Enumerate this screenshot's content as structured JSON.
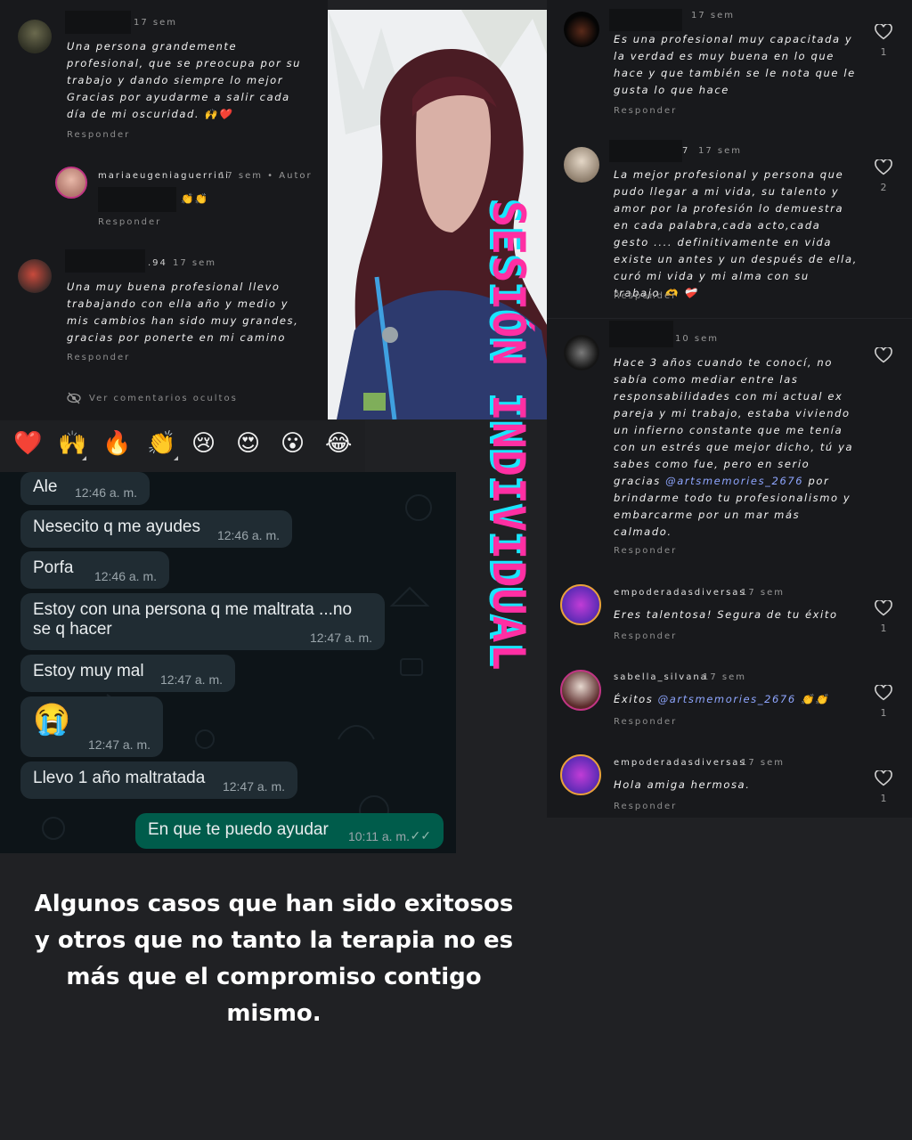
{
  "left_comments": [
    {
      "time": "17 sem",
      "text": "Una persona grandemente profesional, que se preocupa por su trabajo y dando siempre lo mejor Gracias por ayudarme a salir cada día de mi oscuridad. 🙌❤️",
      "reply": "Responder"
    },
    {
      "username": "mariaeugeniaguerrini",
      "time": "17 sem • Autor",
      "text": "👏👏",
      "reply": "Responder"
    },
    {
      "username_suffix": ".94",
      "time": "17 sem",
      "text": "Una muy buena profesional llevo trabajando con ella año y medio y mis cambios han sido muy grandes, gracias por ponerte en mi camino",
      "reply": "Responder"
    }
  ],
  "hidden_comments": "Ver comentarios ocultos",
  "emoji_bar": [
    "❤️",
    "🙌",
    "🔥",
    "👏",
    "😢",
    "😍",
    "😮",
    "😂"
  ],
  "chat": {
    "messages": [
      {
        "text": "Ale",
        "time": "12:46 a. m."
      },
      {
        "text": "Nesecito q me ayudes",
        "time": "12:46 a. m."
      },
      {
        "text": "Porfa",
        "time": "12:46 a. m."
      },
      {
        "text_line1": "Estoy con una persona q me maltrata ...no",
        "text_line2": "se q hacer",
        "time": "12:47 a. m."
      },
      {
        "text": "Estoy muy mal",
        "time": "12:47 a. m."
      },
      {
        "text": "😭",
        "time": "12:47 a. m."
      },
      {
        "text": "Llevo 1 año maltratada",
        "time": "12:47 a. m."
      },
      {
        "text": "En que te puedo ayudar",
        "time": "10:11 a. m.",
        "ticks": "✓✓"
      }
    ]
  },
  "right_comments": [
    {
      "time": "17 sem",
      "text": "Es una profesional muy capacitada y la verdad es muy buena en lo que hace y que también se le nota que le gusta lo que hace",
      "reply": "Responder",
      "likes": "1"
    },
    {
      "username_suffix": "7",
      "time": "17 sem",
      "text": "La mejor profesional y persona que pudo llegar a mi vida, su talento y amor por la profesión lo demuestra en cada palabra,cada acto,cada gesto .... definitivamente en vida existe un antes y un después de ella, curó mi vida y mi alma con su trabajo 🫶 ❤️‍🩹",
      "reply": "Responder",
      "likes": "2"
    },
    {
      "time": "10 sem",
      "text_before": "Hace 3 años cuando te conocí, no sabía como mediar entre las responsabilidades con mi actual ex pareja y mi trabajo, estaba viviendo un infierno constante que me tenía con un estrés que mejor dicho, tú ya sabes como fue, pero en serio gracias ",
      "mention": "@artsmemories_2676",
      "text_after": " por brindarme todo tu profesionalismo y embarcarme por un mar más calmado.",
      "reply": "Responder"
    },
    {
      "username": "empoderadasdiversas",
      "time": "17 sem",
      "text": "Eres talentosa! Segura de tu éxito",
      "reply": "Responder",
      "likes": "1"
    },
    {
      "username": "sabella_silvana",
      "time": "17 sem",
      "text_before": "Éxitos ",
      "mention": "@artsmemories_2676",
      "text_after": " 👏👏",
      "reply": "Responder",
      "likes": "1"
    },
    {
      "username": "empoderadasdiversas",
      "time": "17 sem",
      "text": "Hola amiga hermosa.",
      "reply": "Responder",
      "likes": "1"
    }
  ],
  "vertical_title": "SESIÓN INDIVIDUAL",
  "caption": "Algunos casos que han sido exitosos y otros que no tanto la terapia no es más que el compromiso contigo mismo.",
  "colors": {
    "background": "#202124",
    "title_pink": "#ff2fa3",
    "title_cyan": "#19e6ff",
    "mention": "#8fa6ff",
    "outgoing_bubble": "#005c4b"
  }
}
